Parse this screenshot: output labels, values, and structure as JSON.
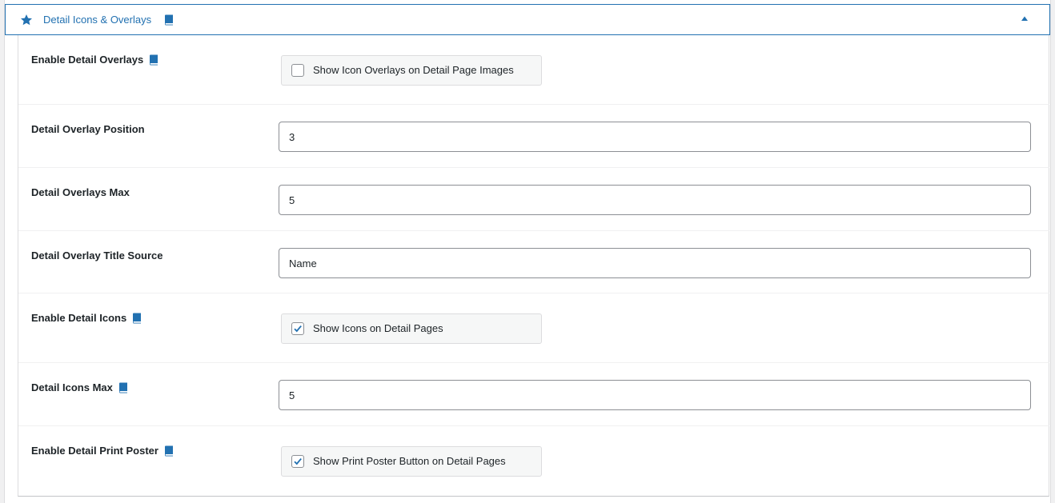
{
  "section": {
    "title": "Detail Icons & Overlays",
    "accent_color": "#2271b1",
    "header_icon": "star-icon",
    "doc_icon": "book-icon",
    "toggle_icon": "caret-up-icon"
  },
  "rows": [
    {
      "label": "Enable Detail Overlays",
      "has_doc_icon": true,
      "type": "checkbox",
      "checkbox_label": "Show Icon Overlays on Detail Page Images",
      "checked": false
    },
    {
      "label": "Detail Overlay Position",
      "has_doc_icon": false,
      "type": "text",
      "value": "3"
    },
    {
      "label": "Detail Overlays Max",
      "has_doc_icon": false,
      "type": "text",
      "value": "5"
    },
    {
      "label": "Detail Overlay Title Source",
      "has_doc_icon": false,
      "type": "text",
      "value": "Name"
    },
    {
      "label": "Enable Detail Icons",
      "has_doc_icon": true,
      "type": "checkbox",
      "checkbox_label": "Show Icons on Detail Pages",
      "checked": true
    },
    {
      "label": "Detail Icons Max",
      "has_doc_icon": true,
      "type": "text",
      "value": "5"
    },
    {
      "label": "Enable Detail Print Poster",
      "has_doc_icon": true,
      "type": "checkbox",
      "checkbox_label": "Show Print Poster Button on Detail Pages",
      "checked": true
    }
  ]
}
